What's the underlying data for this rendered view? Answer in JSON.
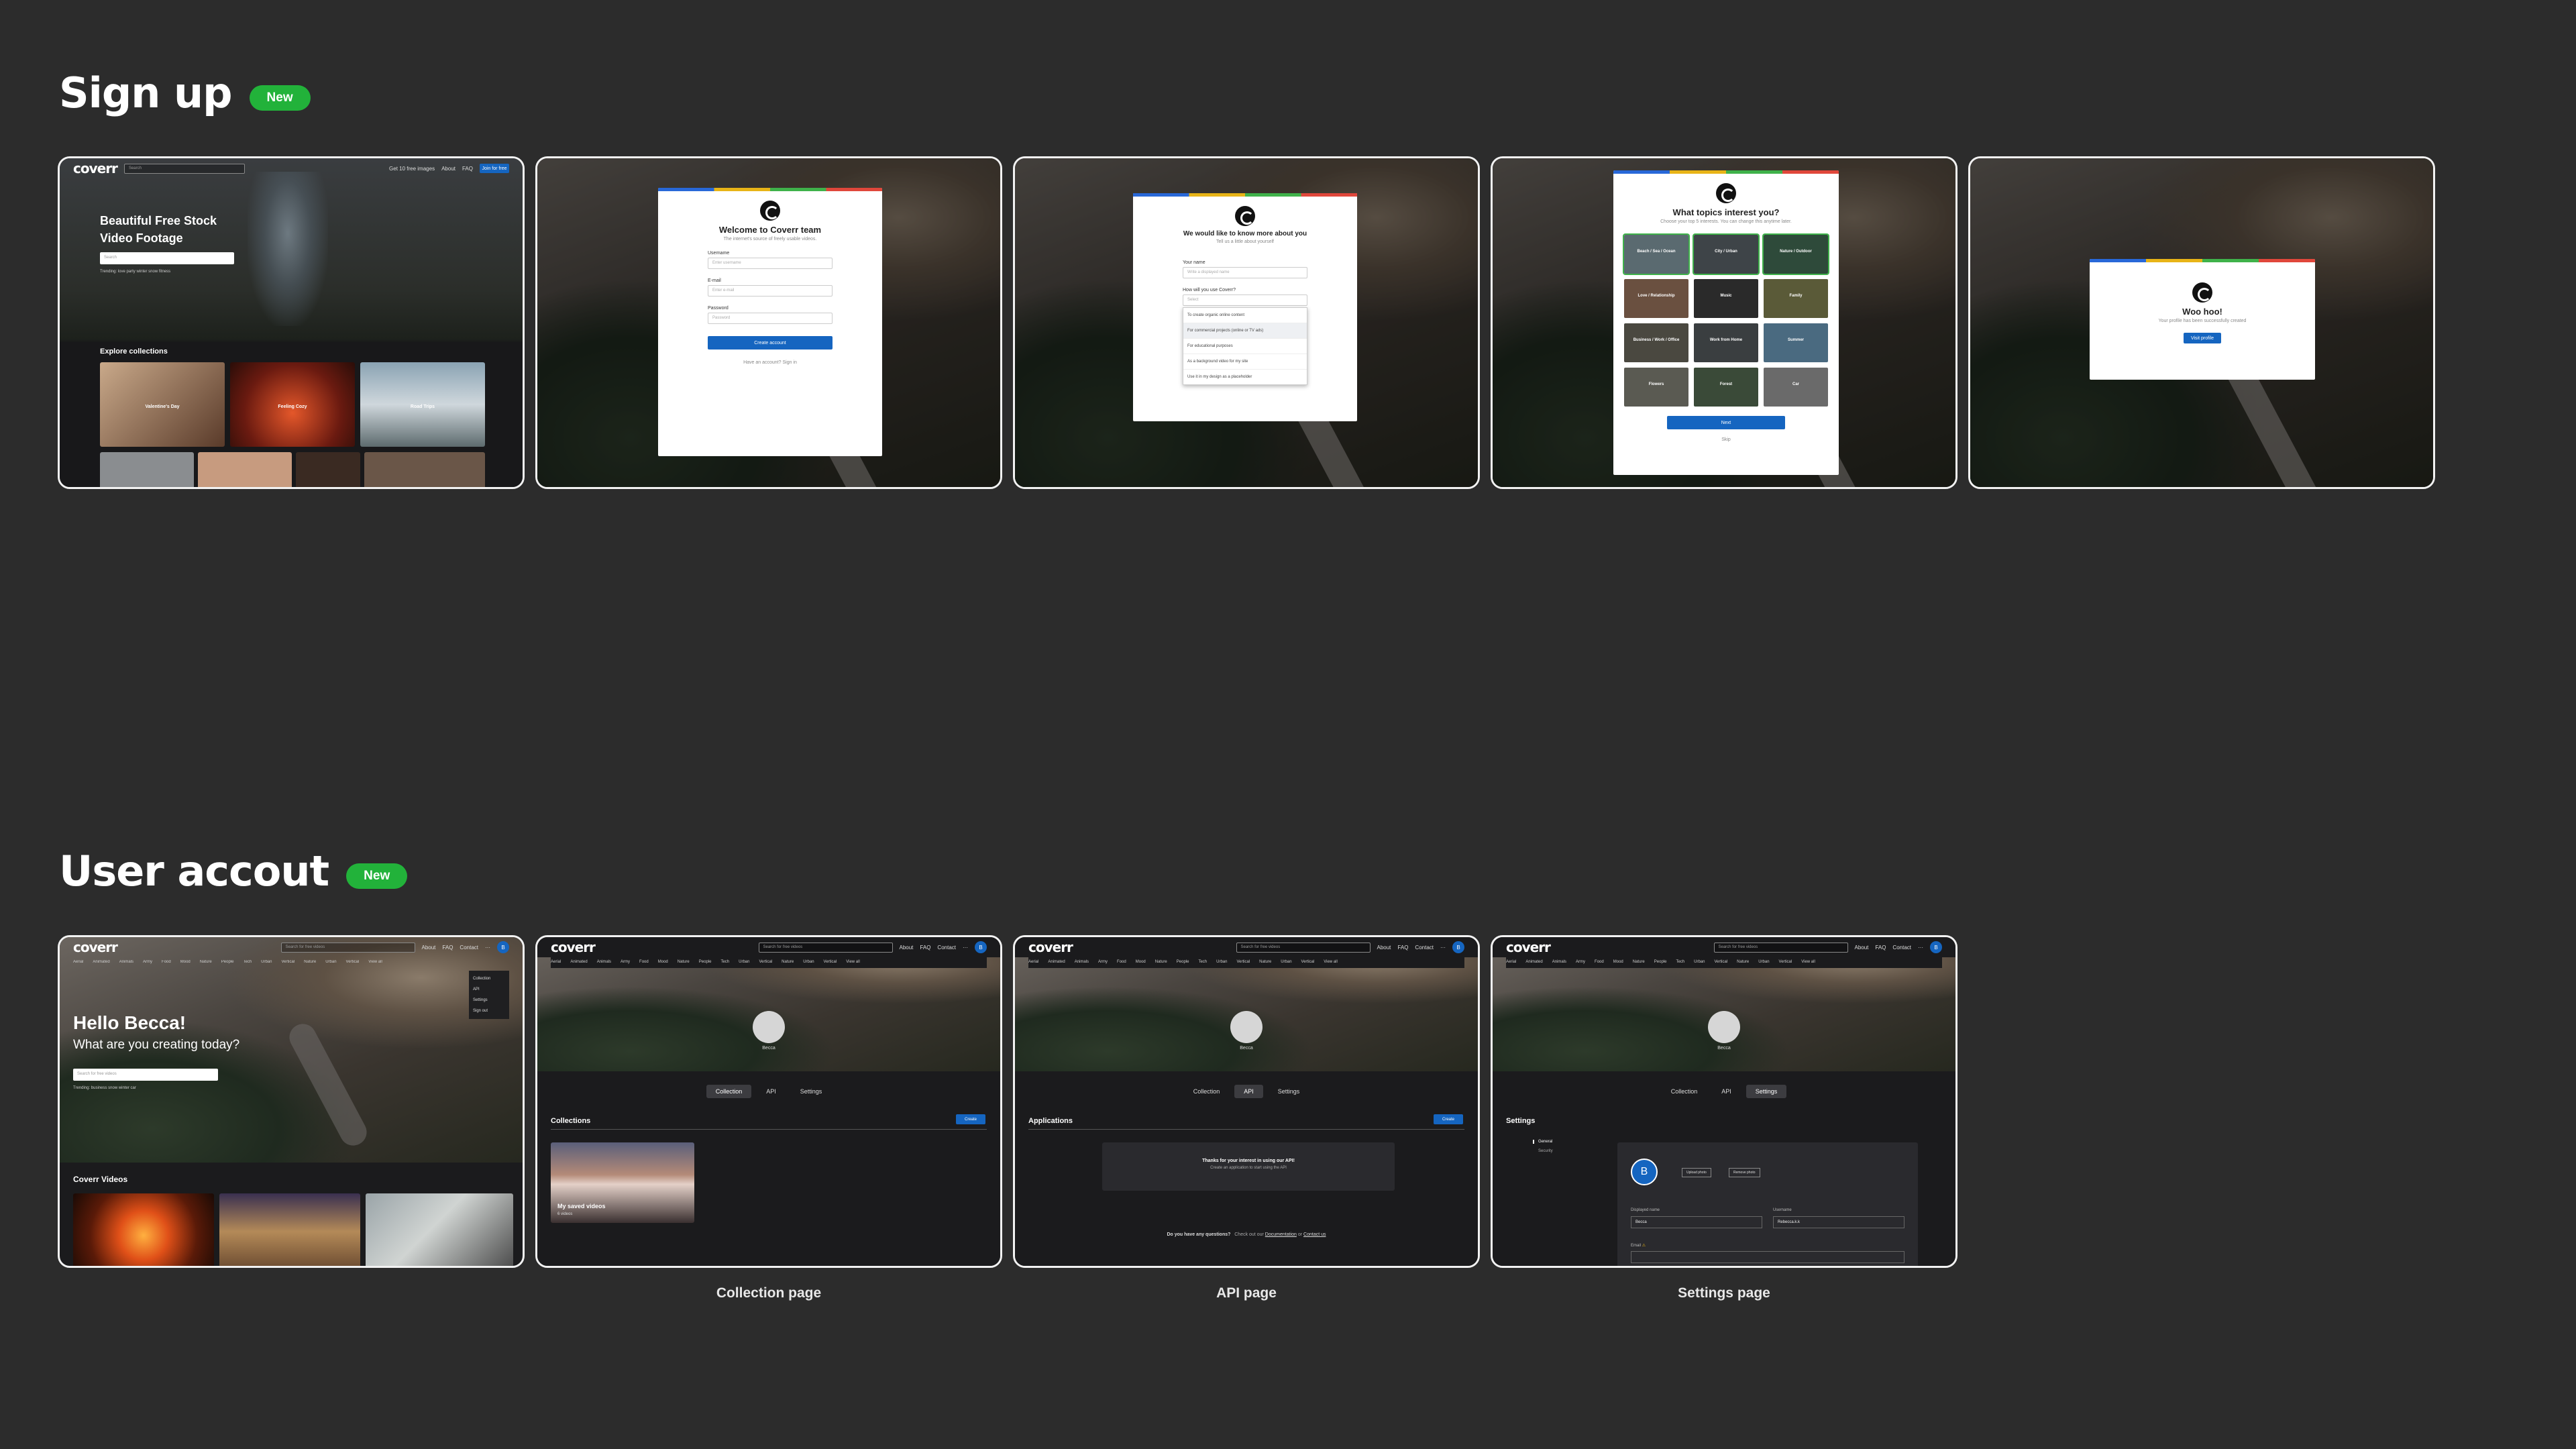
{
  "sections": {
    "signup": {
      "title": "Sign up",
      "badge": "New"
    },
    "account": {
      "title": "User accout",
      "badge": "New"
    }
  },
  "site": {
    "brand": "coverr",
    "search_placeholder": "Search for free videos",
    "nav": [
      "About",
      "FAQ",
      "Contact"
    ],
    "more": "···",
    "avatar_letter": "B",
    "categories": [
      "Aerial",
      "Animated",
      "Animals",
      "Army",
      "Food",
      "Mood",
      "Nature",
      "People",
      "Tech",
      "Urban",
      "Vertical",
      "Nature",
      "Urban",
      "Vertical",
      "View all"
    ]
  },
  "screens": {
    "landing": {
      "hero_title_1": "Beautiful Free Stock",
      "hero_title_2": "Video Footage",
      "search_placeholder": "Search",
      "join": "Join for free",
      "explore": "Explore collections",
      "tiles": [
        "Valentine's Day",
        "Feeling Cozy",
        "Road Trips"
      ],
      "trending": "Trending:  love  party  winter  snow  fitness",
      "top_nav": [
        "Get 10 free images",
        "About",
        "FAQ"
      ]
    },
    "welcome": {
      "title": "Welcome to Coverr team",
      "sub": "The internet's source of freely usable videos.",
      "fields": [
        {
          "label": "Username",
          "ph": "Enter username"
        },
        {
          "label": "E-mail",
          "ph": "Enter e-mail"
        },
        {
          "label": "Password",
          "ph": "Password"
        }
      ],
      "cta": "Create account",
      "signin": "Have an account? Sign in"
    },
    "about": {
      "title": "We would like to know more about you",
      "sub": "Tell us a little about yourself",
      "name_label": "Your name",
      "name_ph": "Write a displayed name",
      "use_label": "How will you use Coverr?",
      "use_ph": "Select",
      "options": [
        "To create organic online content",
        "For commercial projects (online or TV ads)",
        "For educational purposes",
        "As a background video for my site",
        "Use it in my design as a placeholder"
      ]
    },
    "topics": {
      "title": "What topics interest you?",
      "sub": "Choose your top 5 interests. You can change this anytime later.",
      "items": [
        "Beach / Sea / Ocean",
        "City / Urban",
        "Nature / Outdoor",
        "Love / Relationship",
        "Music",
        "Family",
        "Business / Work / Office",
        "Work from Home",
        "Summer",
        "Flowers",
        "Forest",
        "Car"
      ],
      "cta": "Next",
      "skip": "Skip"
    },
    "woohoo": {
      "title": "Woo hoo!",
      "sub": "Your profile has been successfully created",
      "cta": "Visit profile"
    },
    "home": {
      "greet": "Hello Becca!",
      "question": "What are you creating today?",
      "search_ph": "Search for free videos",
      "trending": "Trending:  business  snow  winter  car",
      "videos_title": "Coverr Videos",
      "menu": [
        "Collection",
        "API",
        "Settings",
        "Sign out"
      ]
    },
    "collection": {
      "caption": "Collection page",
      "tabs": [
        "Collection",
        "API",
        "Settings"
      ],
      "heading": "Collections",
      "create": "Create",
      "card_title": "My saved videos",
      "card_sub": "6 videos",
      "user": "Becca"
    },
    "api": {
      "caption": "API page",
      "tabs": [
        "Collection",
        "API",
        "Settings"
      ],
      "heading": "Applications",
      "create": "Create",
      "box_title": "Thanks for your interest in using our API!",
      "box_sub": "Create an application to start using the API",
      "questions": "Do you have any questions?",
      "check": "Check out our",
      "docs": "Documentation",
      "or": "or",
      "contact": "Contact us",
      "user": "Becca"
    },
    "settings": {
      "caption": "Settings page",
      "tabs": [
        "Collection",
        "API",
        "Settings"
      ],
      "heading": "Settings",
      "side": [
        "General",
        "Security"
      ],
      "upload": "Upload photo",
      "remove": "Remove photo",
      "display_label": "Displayed name",
      "display_val": "Becca",
      "user_label": "Username",
      "user_val": "Rebecca.k.k",
      "email_label": "Email",
      "user": "Becca"
    }
  }
}
